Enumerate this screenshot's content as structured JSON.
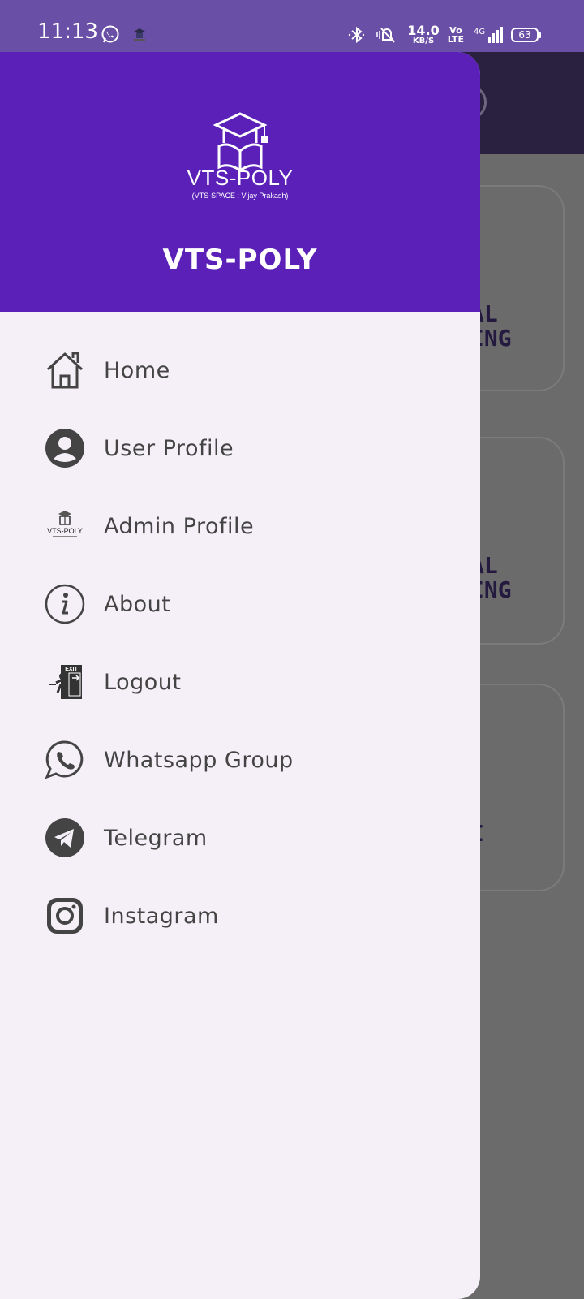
{
  "status_bar": {
    "time": "11:13",
    "speed_value": "14.0",
    "speed_unit": "KB/S",
    "volte": "Vo\nLTE",
    "network": "4G",
    "battery": "63"
  },
  "background": {
    "card1_text": "AL\nING",
    "card2_text": "AL\nING",
    "card3_text": "I"
  },
  "drawer": {
    "logo_text": "VTS-POLY",
    "logo_subtext": "(VTS-SPACE : Vijay Prakash)",
    "title": "VTS-POLY",
    "items": [
      {
        "label": "Home",
        "icon": "home-icon"
      },
      {
        "label": "User Profile",
        "icon": "user-profile-icon"
      },
      {
        "label": "Admin Profile",
        "icon": "admin-logo-icon"
      },
      {
        "label": "About",
        "icon": "info-icon"
      },
      {
        "label": "Logout",
        "icon": "exit-icon"
      },
      {
        "label": "Whatsapp Group",
        "icon": "whatsapp-icon"
      },
      {
        "label": "Telegram",
        "icon": "telegram-icon"
      },
      {
        "label": "Instagram",
        "icon": "instagram-icon"
      }
    ],
    "admin_logo_text": "VTS-POLY"
  },
  "colors": {
    "status_bar": "#6a4fa7",
    "header": "#5a20b8",
    "drawer_bg": "#f5f0f8",
    "scrim": "#6b6b6b"
  }
}
